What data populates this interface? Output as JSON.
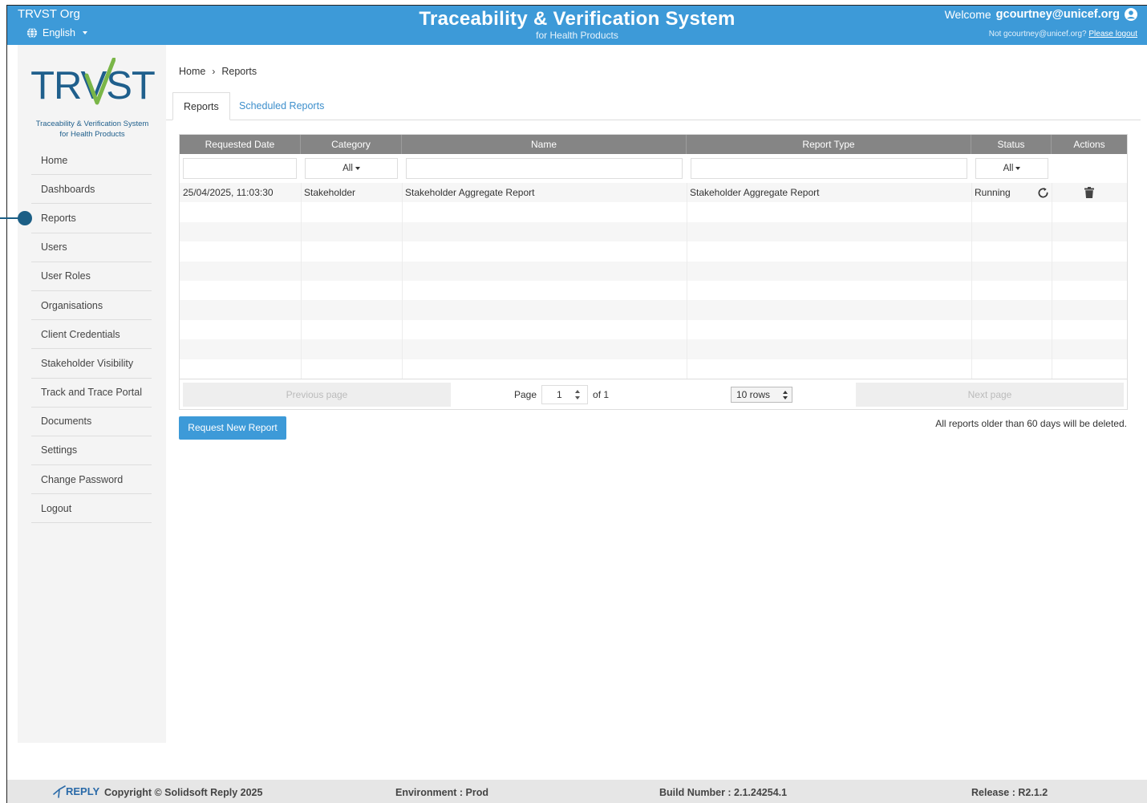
{
  "header": {
    "org": "TRVST Org",
    "language": "English",
    "title": "Traceability & Verification System",
    "subtitle": "for Health Products",
    "welcome_prefix": "Welcome",
    "username": "gcourtney@unicef.org",
    "not_user": "Not gcourtney@unicef.org?",
    "logout_link": "Please logout",
    "color": "#3d9ad8"
  },
  "logo": {
    "text": "TRVST",
    "line1": "Traceability & Verification System",
    "line2": "for Health Products"
  },
  "sidebar": {
    "items": [
      {
        "label": "Home"
      },
      {
        "label": "Dashboards"
      },
      {
        "label": "Reports"
      },
      {
        "label": "Users"
      },
      {
        "label": "User Roles"
      },
      {
        "label": "Organisations"
      },
      {
        "label": "Client Credentials"
      },
      {
        "label": "Stakeholder Visibility"
      },
      {
        "label": "Track and Trace Portal"
      },
      {
        "label": "Documents"
      },
      {
        "label": "Settings"
      },
      {
        "label": "Change Password"
      },
      {
        "label": "Logout"
      }
    ]
  },
  "breadcrumb": {
    "home": "Home",
    "current": "Reports"
  },
  "tabs": [
    {
      "label": "Reports",
      "active": true
    },
    {
      "label": "Scheduled Reports",
      "active": false
    }
  ],
  "table": {
    "columns": [
      "Requested Date",
      "Category",
      "Name",
      "Report Type",
      "Status",
      "Actions"
    ],
    "filters": {
      "category": "All",
      "status": "All"
    },
    "rows": [
      {
        "requested_date": "25/04/2025, 11:03:30",
        "category": "Stakeholder",
        "name": "Stakeholder Aggregate Report",
        "report_type": "Stakeholder Aggregate Report",
        "status": "Running",
        "actions": [
          "refresh-icon",
          "trash-icon"
        ]
      }
    ]
  },
  "pager": {
    "previous": "Previous page",
    "page_label": "Page",
    "page": "1",
    "of_label": "of 1",
    "rows": "10 rows",
    "next": "Next page"
  },
  "actions": {
    "request_new": "Request New Report",
    "notice": "All reports older than 60 days will be deleted."
  },
  "footer": {
    "reply": "REPLY",
    "copyright": "Copyright © Solidsoft Reply 2025",
    "environment": "Environment : Prod",
    "build": "Build Number : 2.1.24254.1",
    "release": "Release : R2.1.2"
  }
}
